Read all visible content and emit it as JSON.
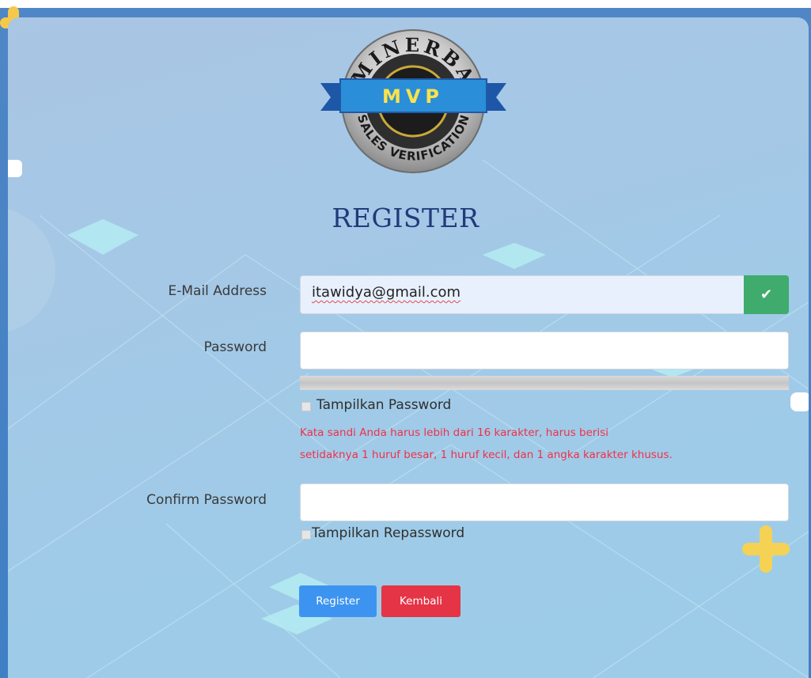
{
  "colors": {
    "primary": "#3d94f0",
    "danger": "#e53446",
    "success": "#3fab6c",
    "title": "#223a7a",
    "warning_text": "#f0304a"
  },
  "logo": {
    "top_text": "MINERBA",
    "ribbon_text": "MVP",
    "bottom_text": "SALES VERIFICATION"
  },
  "form": {
    "title": "REGISTER",
    "email": {
      "label": "E-Mail Address",
      "value": "itawidya@gmail.com",
      "status_icon": "check-icon"
    },
    "password": {
      "label": "Password",
      "value": "",
      "show_label": "Tampilkan Password",
      "warning_line1": "Kata sandi Anda harus lebih dari 16 karakter, harus berisi",
      "warning_line2": "setidaknya 1 huruf besar, 1 huruf kecil, dan 1 angka karakter khusus."
    },
    "confirm": {
      "label": "Confirm Password",
      "value": "",
      "show_label": "Tampilkan Repassword"
    },
    "buttons": {
      "register": "Register",
      "back": "Kembali"
    }
  }
}
